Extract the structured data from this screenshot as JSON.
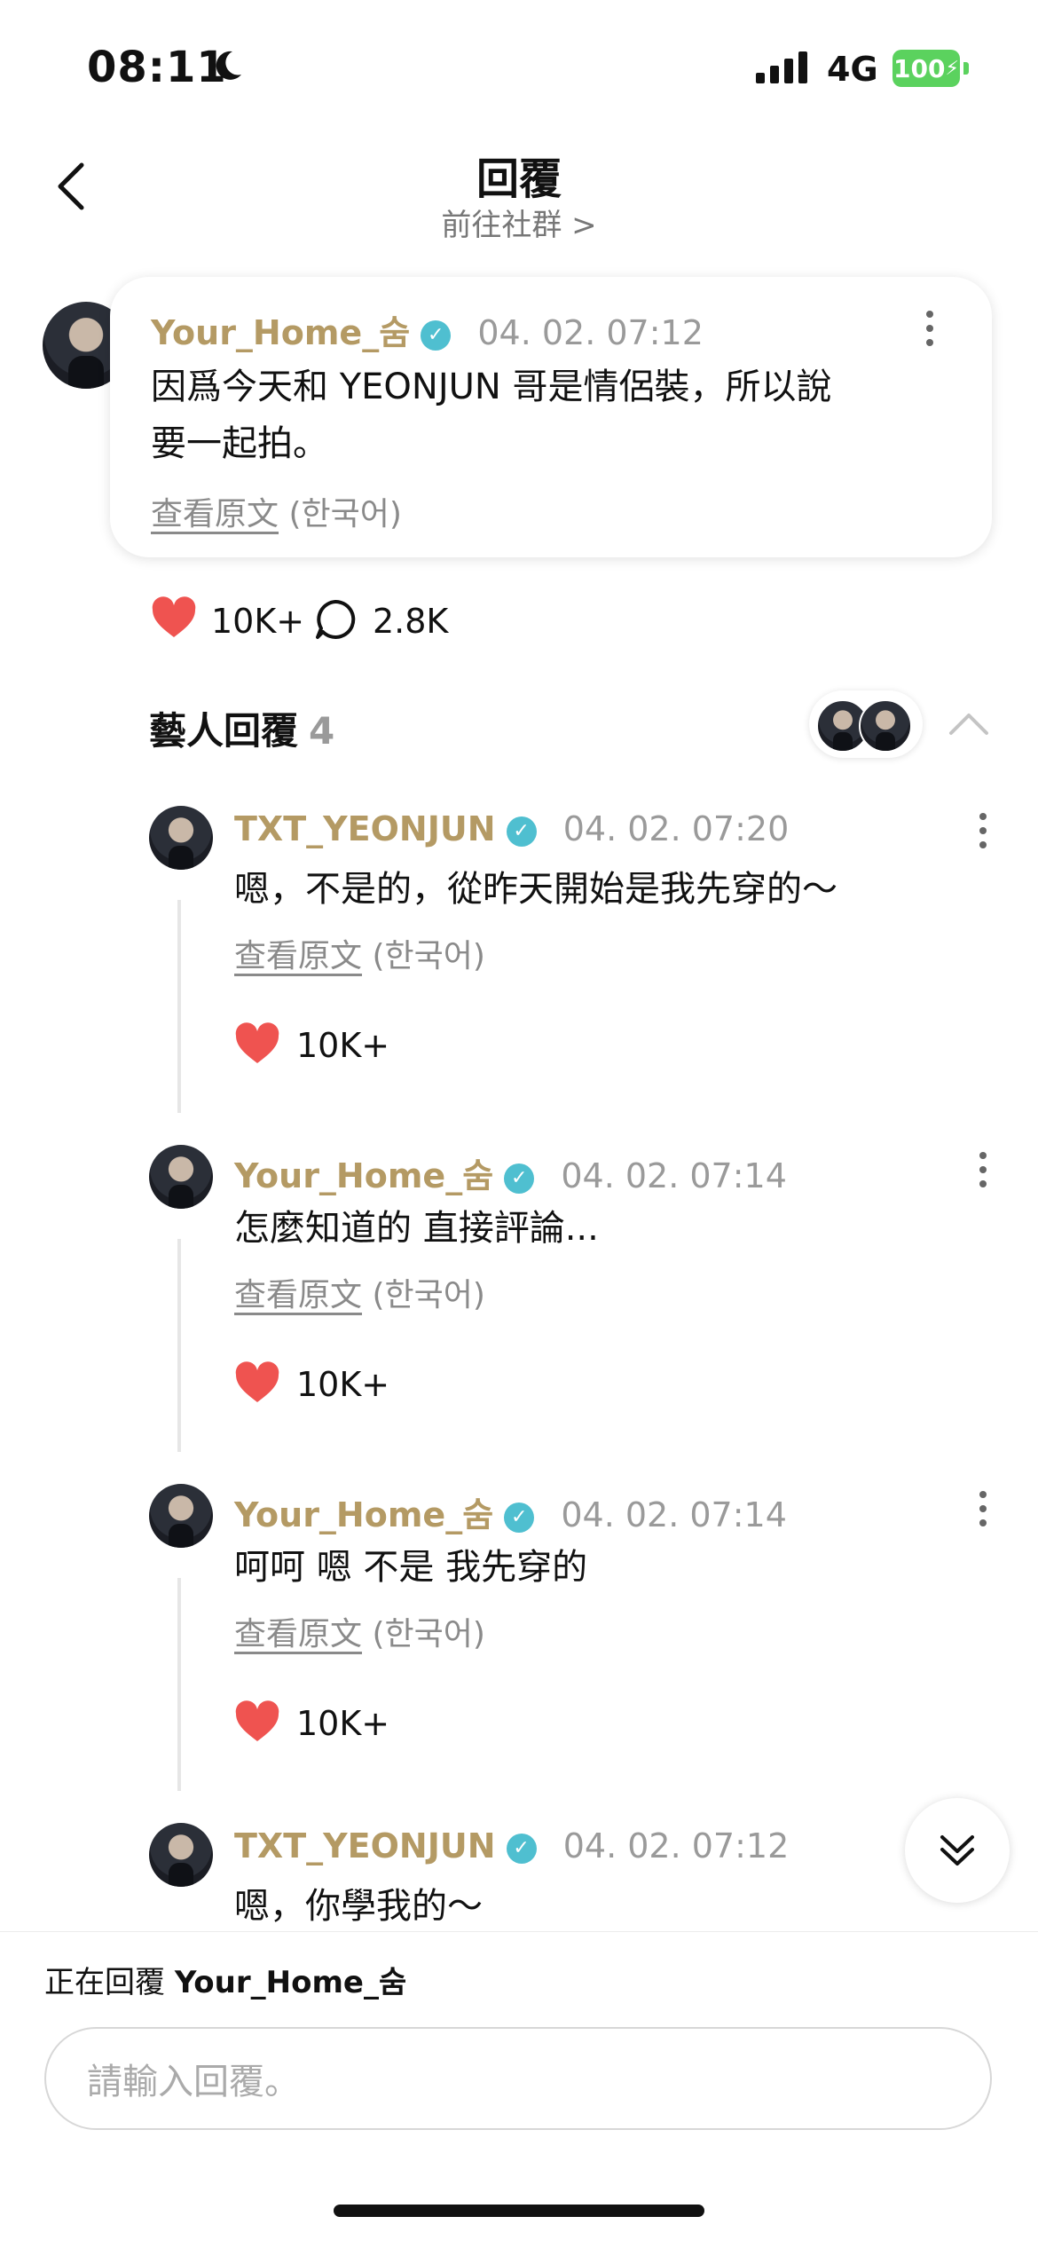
{
  "status_bar": {
    "time": "08:11",
    "network": "4G",
    "battery": "100"
  },
  "header": {
    "title": "回覆",
    "subtitle": "前往社群 >"
  },
  "main_comment": {
    "author": "Your_Home_숨",
    "date": "04. 02. 07:12",
    "text_line1": "因爲今天和 YEONJUN 哥是情侶裝，所以說",
    "text_line2": "要一起拍。",
    "view_original": "查看原文",
    "language": "(한국어)",
    "likes": "10K+",
    "comments": "2.8K"
  },
  "artist_replies": {
    "title": "藝人回覆",
    "count": "4"
  },
  "replies": [
    {
      "author": "TXT_YEONJUN",
      "date": "04. 02. 07:20",
      "text": "嗯，不是的，從昨天開始是我先穿的～",
      "view_original": "查看原文",
      "language": "(한국어)",
      "likes": "10K+"
    },
    {
      "author": "Your_Home_숨",
      "date": "04. 02. 07:14",
      "text": "怎麼知道的 直接評論...",
      "view_original": "查看原文",
      "language": "(한국어)",
      "likes": "10K+"
    },
    {
      "author": "Your_Home_숨",
      "date": "04. 02. 07:14",
      "text": "呵呵 嗯 不是 我先穿的",
      "view_original": "查看原文",
      "language": "(한국어)",
      "likes": "10K+"
    },
    {
      "author": "TXT_YEONJUN",
      "date": "04. 02. 07:12",
      "text": "嗯，你學我的～"
    }
  ],
  "composer": {
    "replying_prefix": "正在回覆",
    "replying_to": "Your_Home_숨",
    "placeholder": "請輸入回覆。"
  },
  "colors": {
    "username": "#b49a64",
    "verified": "#4fbfd0",
    "heart": "#ef5350",
    "battery": "#5bd25e"
  },
  "icons": [
    "moon-icon",
    "signal-icon",
    "back-chevron-icon",
    "verified-icon",
    "more-icon",
    "heart-icon",
    "comment-icon",
    "chevron-up-icon",
    "double-chevron-down-icon"
  ]
}
